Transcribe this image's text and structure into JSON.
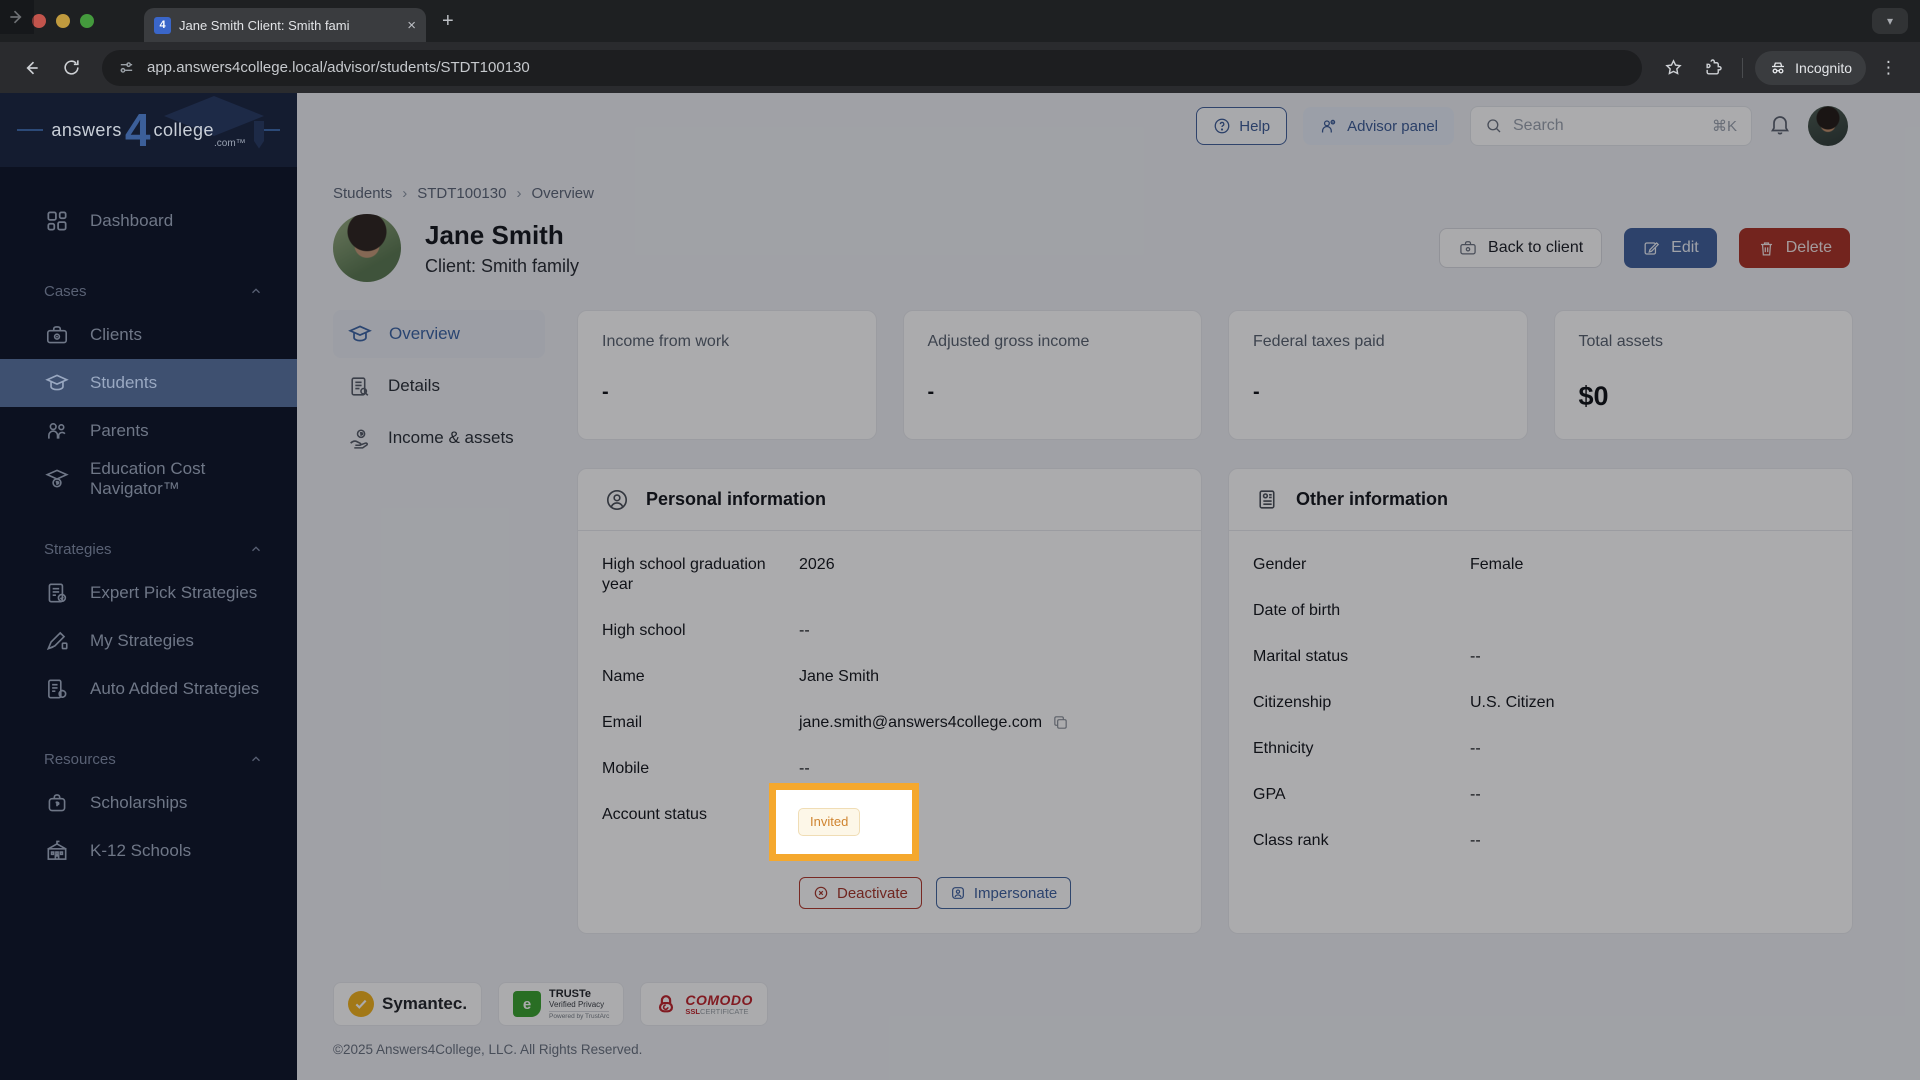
{
  "browser": {
    "tab_title": "Jane Smith Client: Smith fami",
    "favicon_text": "4",
    "url": "app.answers4college.local/advisor/students/STDT100130",
    "incognito_label": "Incognito"
  },
  "icons": {
    "close": "×",
    "new_tab": "+",
    "kebab": "⋮",
    "chevron_down": "▾",
    "breadcrumb_sep": "›"
  },
  "sidebar": {
    "logo": {
      "left": "answers",
      "num": "4",
      "right": "college",
      "tld": ".com™"
    },
    "dashboard": "Dashboard",
    "active_item": "Students",
    "sections": [
      {
        "title": "Cases",
        "items": [
          "Clients",
          "Students",
          "Parents",
          "Education Cost Navigator™"
        ]
      },
      {
        "title": "Strategies",
        "items": [
          "Expert Pick Strategies",
          "My Strategies",
          "Auto Added Strategies"
        ]
      },
      {
        "title": "Resources",
        "items": [
          "Scholarships",
          "K-12 Schools"
        ]
      }
    ]
  },
  "topbar": {
    "help": "Help",
    "advisor_panel": "Advisor panel",
    "search_placeholder": "Search",
    "search_shortcut": "⌘K"
  },
  "page": {
    "breadcrumb": [
      "Students",
      "STDT100130",
      "Overview"
    ],
    "title": "Jane Smith",
    "subtitle": "Client: Smith family",
    "back_button": "Back to client",
    "edit_button": "Edit",
    "delete_button": "Delete"
  },
  "subnav": {
    "active": "Overview",
    "items": [
      "Overview",
      "Details",
      "Income & assets"
    ]
  },
  "stats": [
    {
      "label": "Income from work",
      "value": "-"
    },
    {
      "label": "Adjusted gross income",
      "value": "-"
    },
    {
      "label": "Federal taxes paid",
      "value": "-"
    },
    {
      "label": "Total assets",
      "value": "$0"
    }
  ],
  "personal_info": {
    "title": "Personal information",
    "rows": [
      {
        "label": "High school graduation year",
        "value": "2026"
      },
      {
        "label": "High school",
        "value": "--"
      },
      {
        "label": "Name",
        "value": "Jane Smith"
      },
      {
        "label": "Email",
        "value": "jane.smith@answers4college.com"
      },
      {
        "label": "Mobile",
        "value": "--"
      },
      {
        "label": "Account status",
        "value": "Invited"
      }
    ],
    "deactivate_button": "Deactivate",
    "impersonate_button": "Impersonate"
  },
  "other_info": {
    "title": "Other information",
    "rows": [
      {
        "label": "Gender",
        "value": "Female"
      },
      {
        "label": "Date of birth",
        "value": ""
      },
      {
        "label": "Marital status",
        "value": "--"
      },
      {
        "label": "Citizenship",
        "value": "U.S. Citizen"
      },
      {
        "label": "Ethnicity",
        "value": "--"
      },
      {
        "label": "GPA",
        "value": "--"
      },
      {
        "label": "Class rank",
        "value": "--"
      }
    ]
  },
  "footer": {
    "badges": [
      {
        "name": "Symantec",
        "text": "Symantec."
      },
      {
        "name": "TRUSTe",
        "line1": "TRUSTe",
        "line2": "Verified Privacy",
        "line3": "Powered by TrustArc"
      },
      {
        "name": "COMODO",
        "line1": "COMODO",
        "line2": "SSL",
        "line2b": "CERTIFICATE"
      }
    ],
    "copyright": "©2025 Answers4College, LLC. All Rights Reserved."
  },
  "colors": {
    "accent_blue": "#40609b",
    "delete_red": "#aa3227",
    "highlight_orange": "#f5a82d",
    "invited_text": "#cf8430",
    "invited_bg": "#fdf7e8",
    "sidebar_bg": "#0c1120",
    "sidebar_active_bg": "#3e5070"
  }
}
